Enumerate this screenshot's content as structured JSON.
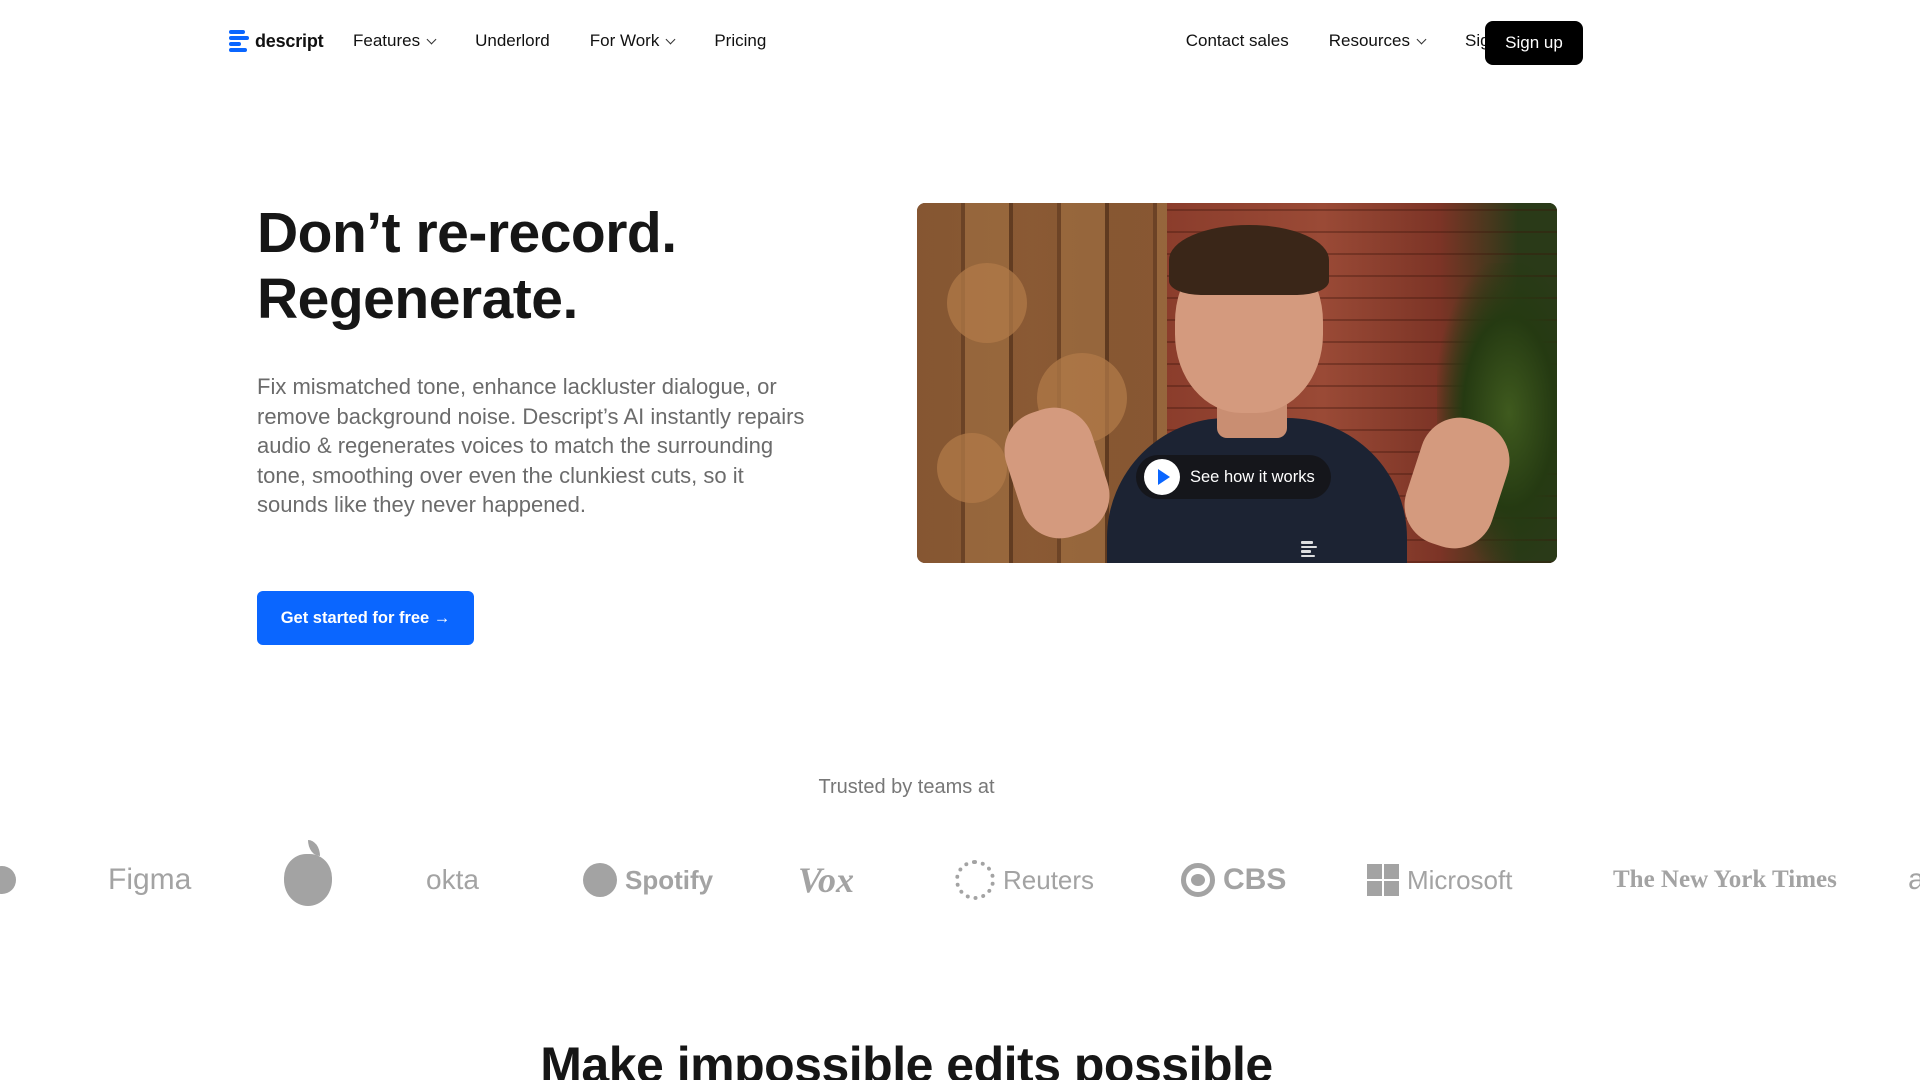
{
  "nav": {
    "logo_text": "descript",
    "left_items": [
      {
        "label": "Features",
        "has_dropdown": true
      },
      {
        "label": "Underlord",
        "has_dropdown": false
      },
      {
        "label": "For Work",
        "has_dropdown": true
      },
      {
        "label": "Pricing",
        "has_dropdown": false
      }
    ],
    "right_items": [
      {
        "label": "Contact sales",
        "has_dropdown": false
      },
      {
        "label": "Resources",
        "has_dropdown": true
      },
      {
        "label": "Sign in",
        "has_dropdown": false
      }
    ],
    "signup_label": "Sign up"
  },
  "hero": {
    "headline_line1": "Don’t re-record.",
    "headline_line2": "Regenerate.",
    "subtext": "Fix mismatched tone, enhance lackluster dialogue, or remove background noise. Descript’s AI instantly repairs audio & regenerates voices to match the surrounding tone, smoothing over even the clunkiest cuts, so it sounds like they never happened.",
    "cta_label": "Get started for free →",
    "video_button_label": "See how it works"
  },
  "trusted": {
    "label": "Trusted by teams at",
    "logos": [
      "e",
      "Figma",
      "apple-icon",
      "okta",
      "Spotify",
      "Vox",
      "Reuters",
      "CBS",
      "Microsoft",
      "The New York Times",
      "a"
    ]
  },
  "next_section": {
    "title": "Make impossible edits possible"
  },
  "colors": {
    "accent": "#0a66ff",
    "signup_bg": "#000000",
    "logo_gray": "#a3a3a3"
  }
}
